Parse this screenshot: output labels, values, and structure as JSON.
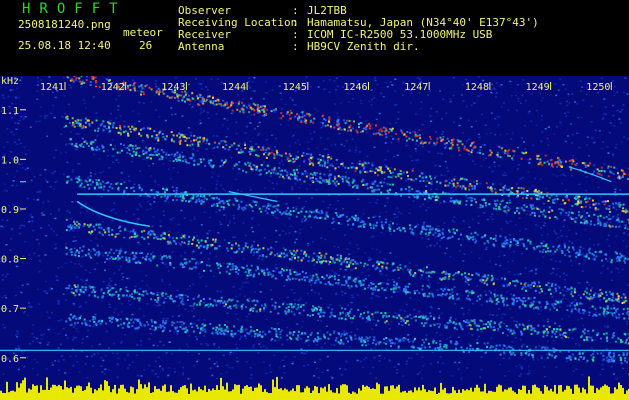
{
  "header": {
    "logo": "HROFFT",
    "filename": "2508181240.png",
    "datetime": "25.08.18 12:40",
    "meteor_label": "meteor",
    "meteor_count": "26",
    "info": [
      {
        "label": "Observer",
        "value": "JL2TBB"
      },
      {
        "label": "Receiving Location",
        "value": "Hamamatsu, Japan (N34°40' E137°43')"
      },
      {
        "label": "Receiver",
        "value": "ICOM IC-R2500 53.1000MHz USB"
      },
      {
        "label": "Antenna",
        "value": "HB9CV Zenith dir."
      }
    ]
  },
  "chart_data": {
    "type": "heatmap",
    "description_axis": "time (minutes) vs frequency (kHz)",
    "ylabel": "kHz",
    "x_ticks": [
      "1241",
      "1242",
      "1243",
      "1244",
      "1245",
      "1246",
      "1247",
      "1248",
      "1249",
      "1250"
    ],
    "y_ticks": [
      "1.1",
      "1.0",
      "0.9",
      "0.8",
      "0.7",
      "0.6"
    ],
    "xlim": [
      1241,
      1250
    ],
    "ylim": [
      0.58,
      1.16
    ],
    "colors": {
      "background": "#050a7a",
      "noise_low": "#1236c8",
      "noise_high": "#2f7cff",
      "trace_mid": "#2fd6b0",
      "trace_high": "#f2d23a",
      "trace_peak": "#ff3a1a",
      "carrier": "#33c6ff",
      "noise_floor": "#e8e800"
    },
    "features": {
      "horizontal_carrier_khz": 0.93,
      "floor_line_khz": 0.615
    }
  }
}
